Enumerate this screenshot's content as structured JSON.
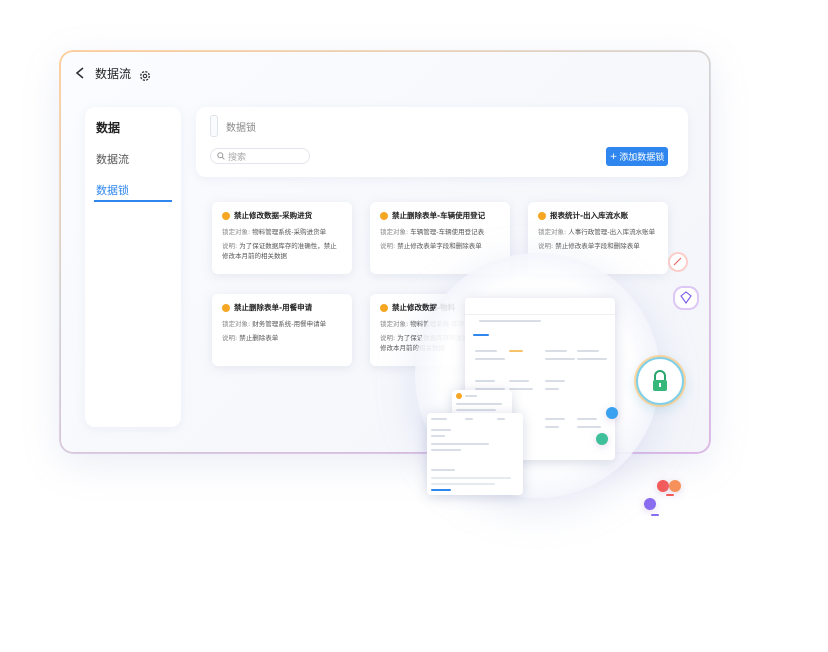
{
  "topbar": {
    "title": "数据流"
  },
  "sidebar": {
    "items": [
      "数据",
      "数据流",
      "数据锁"
    ]
  },
  "panel": {
    "title": "数据锁",
    "search_placeholder": "搜索",
    "add_button": "添加数据锁"
  },
  "cards": [
    {
      "title": "禁止修改数据-采购进货",
      "target_label": "锁定对象:",
      "target": "物料管理系统-采购进货单",
      "desc_label": "说明:",
      "desc": "为了保证数据库存的准确性，禁止修改本月前的相关数据"
    },
    {
      "title": "禁止删除表单-车辆使用登记",
      "target_label": "锁定对象:",
      "target": "车辆管理-车辆使用登记表",
      "desc_label": "说明:",
      "desc": "禁止修改表单字段和删除表单"
    },
    {
      "title": "报表统计-出入库流水账",
      "target_label": "锁定对象:",
      "target": "人事行政管理-出入库流水账单",
      "desc_label": "说明:",
      "desc": "禁止修改表单字段和删除表单"
    },
    {
      "title": "禁止删除表单-用餐申请",
      "target_label": "锁定对象:",
      "target": "财务管理系统-用餐申请单",
      "desc_label": "说明:",
      "desc": "禁止删除表单"
    },
    {
      "title": "禁止修改数据-物料",
      "target_label": "锁定对象:",
      "target": "物料管理系统-库存管理",
      "desc_label": "说明:",
      "desc": "为了保证数据库存的准确性，禁止修改本月前的相关数据"
    }
  ],
  "colors": {
    "accent": "#2f86ee",
    "badge": "#f5a623"
  }
}
